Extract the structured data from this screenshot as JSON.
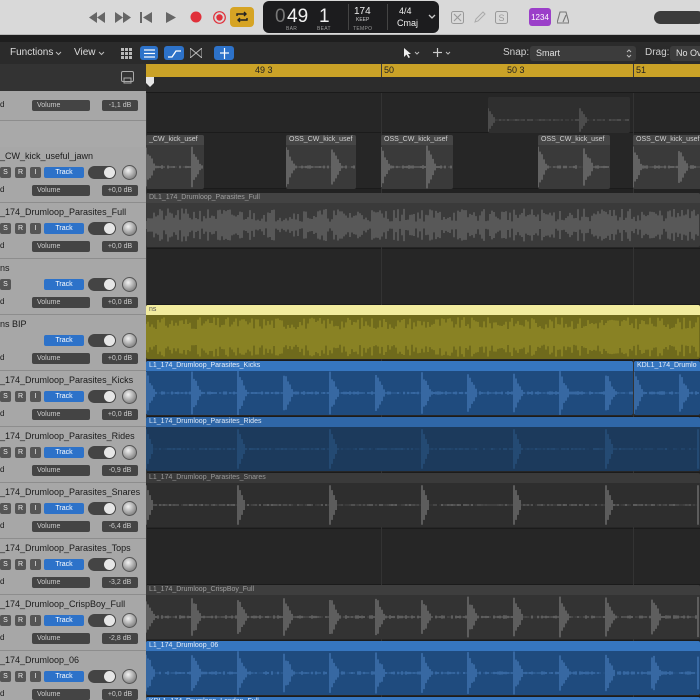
{
  "control_bar": {
    "lcd": {
      "bar": "49",
      "beat": "1",
      "bar_label": "BAR",
      "beat_label": "BEAT",
      "tempo": "174",
      "tempo_sub": "KEEP",
      "tempo_label": "TEMPO",
      "time_sig": "4/4",
      "key": "Cmaj"
    },
    "count_in_label": "1234"
  },
  "toolbar": {
    "functions_label": "Functions",
    "view_label": "View",
    "snap_label": "Snap:",
    "snap_value": "Smart",
    "drag_label": "Drag:",
    "drag_value": "No Ov"
  },
  "ruler": {
    "markers": [
      "49 3",
      "50",
      "50 3",
      "51"
    ]
  },
  "tracks": [
    {
      "name": "",
      "param": "Volume",
      "value": "-1,1 dB"
    },
    {
      "name": "_CW_kick_useful_jawn",
      "param": "Volume",
      "value": "+0,0 dB"
    },
    {
      "name": "_174_Drumloop_Parasites_Full",
      "param": "Volume",
      "value": "+0,0 dB"
    },
    {
      "name": "ns",
      "param": "Volume",
      "value": "+0,0 dB"
    },
    {
      "name": "ns BIP",
      "param": "Volume",
      "value": "+0,0 dB"
    },
    {
      "name": "_174_Drumloop_Parasites_Kicks",
      "param": "Volume",
      "value": "+0,0 dB"
    },
    {
      "name": "_174_Drumloop_Parasites_Rides",
      "param": "Volume",
      "value": "-0,9 dB"
    },
    {
      "name": "_174_Drumloop_Parasites_Snares",
      "param": "Volume",
      "value": "-6,4 dB"
    },
    {
      "name": "_174_Drumloop_Parasites_Tops",
      "param": "Volume",
      "value": "-3,2 dB"
    },
    {
      "name": "_174_Drumloop_CrispBoy_Full",
      "param": "Volume",
      "value": "-2,8 dB"
    },
    {
      "name": "_174_Drumloop_06",
      "param": "Volume",
      "value": "+0,0 dB"
    }
  ],
  "track_button_label": "Track",
  "sri": [
    "S",
    "R",
    "I"
  ],
  "regions": {
    "kick": "OSS_CW_kick_usef",
    "kick_first": "_CW_kick_usef",
    "parasites_full": "DL1_174_Drumloop_Parasites_Full",
    "bip": "ns",
    "kicks_a": "L1_174_Drumloop_Parasites_Kicks",
    "kicks_b": "KDL1_174_Drumlo",
    "rides": "L1_174_Drumloop_Parasites_Rides",
    "snares": "L1_174_Drumloop_Parasites_Snares",
    "crispboy": "L1_174_Drumloop_CrispBoy_Full",
    "loop06": "L1_174_Drumloop_06",
    "bottom": "KDL1_174_Drumloop_London_Full"
  },
  "colors": {
    "control_bg": "#d9d9d9",
    "lcd_bg": "#1c1c1e",
    "record": "#e0303a",
    "cycle": "#d6a424",
    "count_in": "#9b3fc9",
    "ruler": "#caa227",
    "header_bg": "#a7a7a7",
    "track_button": "#2d72c9",
    "region_gray": "#3f3f3f",
    "region_blue": "#2b5d9a",
    "region_yellow": "#6f6a1c"
  }
}
